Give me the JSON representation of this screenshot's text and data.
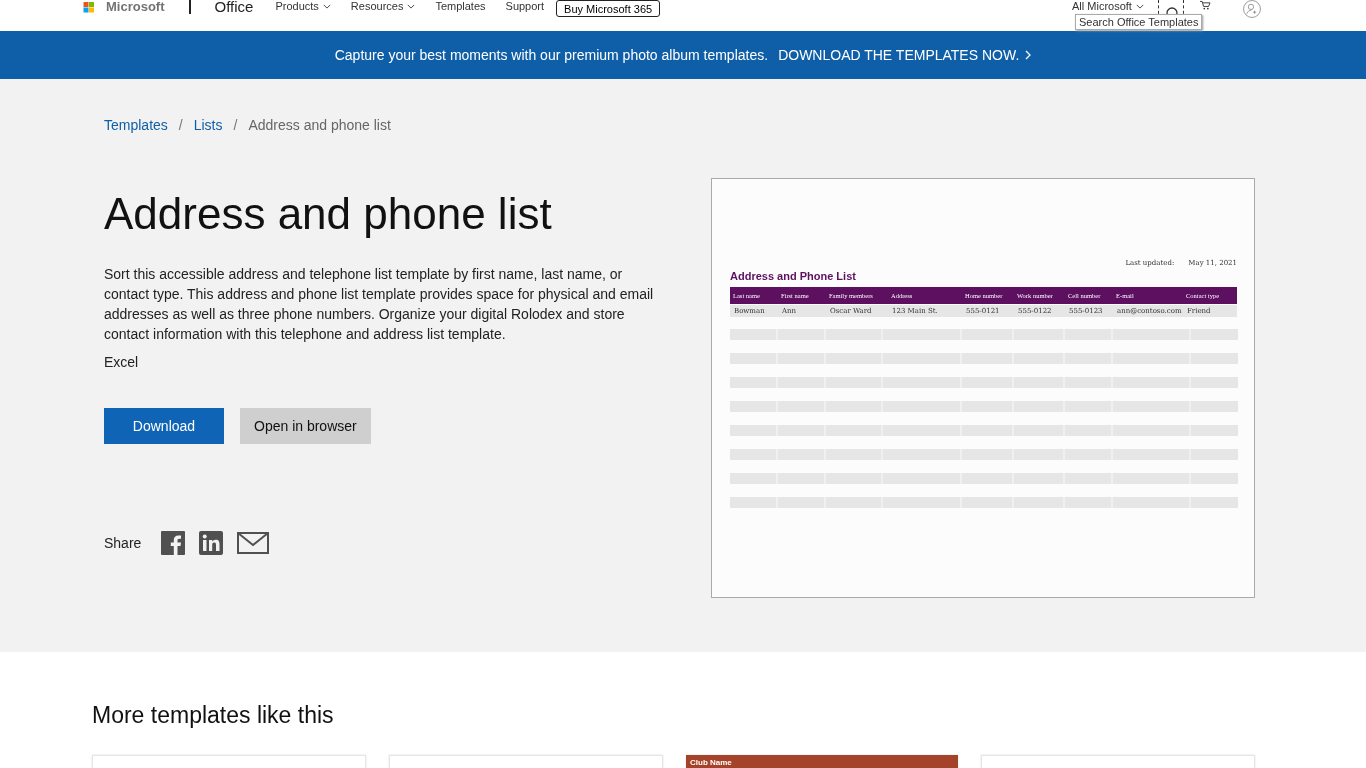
{
  "header": {
    "logo": "Microsoft",
    "product": "Office",
    "nav": [
      {
        "label": "Products",
        "dropdown": true
      },
      {
        "label": "Resources",
        "dropdown": true
      },
      {
        "label": "Templates",
        "dropdown": false
      },
      {
        "label": "Support",
        "dropdown": false
      }
    ],
    "buy_button": "Buy Microsoft 365",
    "all_microsoft": "All Microsoft",
    "search_tooltip": "Search Office Templates"
  },
  "banner": {
    "text": "Capture your best moments with our premium photo album templates.",
    "link": "DOWNLOAD THE TEMPLATES NOW."
  },
  "breadcrumb": [
    {
      "label": "Templates",
      "link": true
    },
    {
      "separator": "/",
      "label": "Lists",
      "link": true
    },
    {
      "separator": "/",
      "label": "Address and phone list",
      "link": false
    }
  ],
  "title": "Address and phone list",
  "description": "Sort this accessible address and telephone list template by first name, last name, or contact type. This address and phone list template provides space for physical and email addresses as well as three phone numbers. Organize your digital Rolodex and store contact information with this telephone and address list template.",
  "app": "Excel",
  "buttons": [
    {
      "label": "Download",
      "kind": "primary"
    },
    {
      "label": "Open in browser",
      "kind": "secondary"
    }
  ],
  "share": {
    "label": "Share",
    "icons": [
      {
        "kind": "facebook"
      },
      {
        "kind": "linkedin"
      },
      {
        "kind": "email"
      }
    ]
  },
  "preview": {
    "title": "Address and Phone List",
    "updated_label": "Last updated:",
    "updated_date": "May 11, 2021",
    "columns": [
      "Last name",
      "First name",
      "Family members",
      "Address",
      "Home number",
      "Work number",
      "Cell number",
      "E-mail",
      "Contact type"
    ],
    "rows": [
      [
        "Bowman",
        "Ann",
        "Oscar Ward",
        "123 Main St.",
        "555-0121",
        "555-0122",
        "555-0123",
        "ann@contoso.com",
        "Friend"
      ]
    ]
  },
  "more": {
    "heading": "More templates like this",
    "cards": [
      {
        "kind": "blank"
      },
      {
        "kind": "blank"
      },
      {
        "kind": "banner",
        "label": "Club Name"
      },
      {
        "kind": "blank"
      }
    ]
  }
}
